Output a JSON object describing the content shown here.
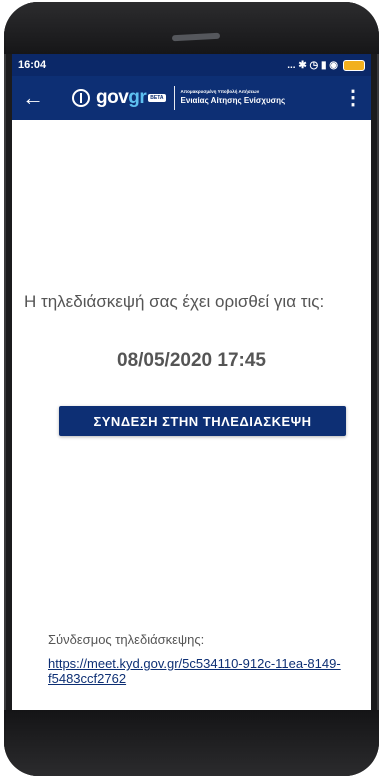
{
  "status_bar": {
    "time": "16:04",
    "icons_text": "... ✱ ◷ ▮ ◉",
    "battery_color": "#f2b01e"
  },
  "app_bar": {
    "back_icon": "←",
    "brand_prefix": "gov",
    "brand_suffix": "gr",
    "beta": "BETA",
    "subtitle_small": "Απομακρυσμένη Υποβολή Αιτήσεων",
    "subtitle_main": "Ενιαίας Αίτησης Ενίσχυσης",
    "more_icon": "⋮",
    "color": "#0d2f74"
  },
  "main": {
    "message": "Η τηλεδιάσκεψή σας έχει ορισθεί για τις:",
    "datetime": "08/05/2020 17:45",
    "join_button": "ΣΥΝΔΕΣΗ ΣΤΗΝ ΤΗΛΕΔΙΑΣΚΕΨΗ",
    "link_label": "Σύνδεσμος τηλεδιάσκεψης:",
    "link_url": "https://meet.kyd.gov.gr/5c534110-912c-11ea-8149-f5483ccf2762"
  }
}
